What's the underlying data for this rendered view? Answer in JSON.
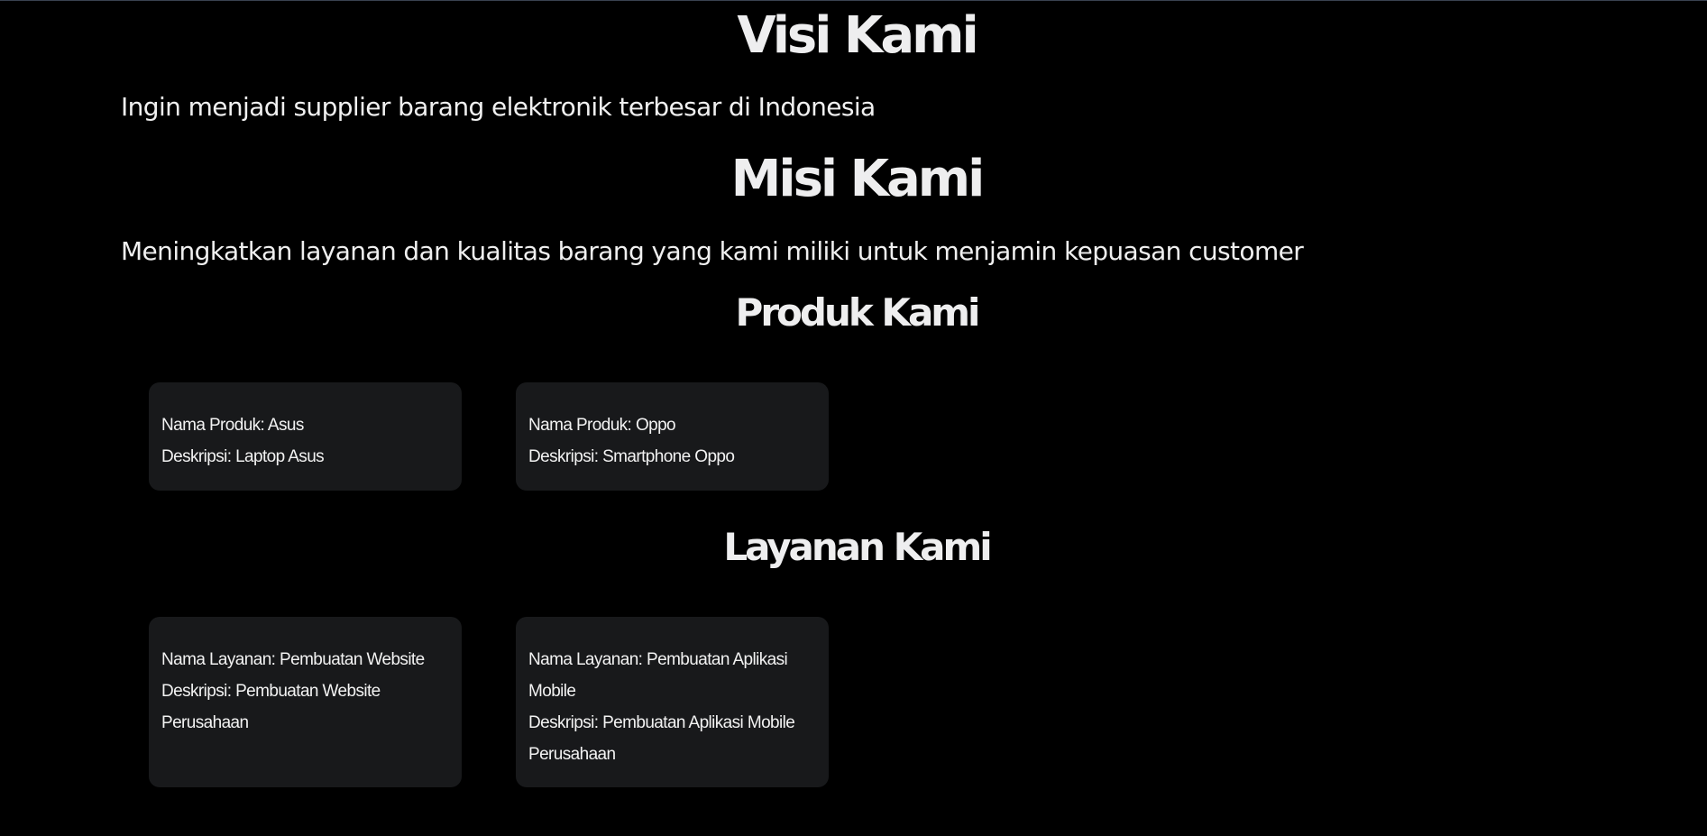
{
  "visi": {
    "title": "Visi Kami",
    "text": "Ingin menjadi supplier barang elektronik terbesar di Indonesia"
  },
  "misi": {
    "title": "Misi Kami",
    "text": "Meningkatkan layanan dan kualitas barang yang kami miliki untuk menjamin kepuasan customer"
  },
  "produk": {
    "title": "Produk Kami",
    "items": [
      {
        "name_label": "Nama Produk:",
        "name": "Asus",
        "desc_label": "Deskripsi:",
        "desc": "Laptop Asus"
      },
      {
        "name_label": "Nama Produk:",
        "name": "Oppo",
        "desc_label": "Deskripsi:",
        "desc": "Smartphone Oppo"
      }
    ]
  },
  "layanan": {
    "title": "Layanan Kami",
    "items": [
      {
        "name_label": "Nama Layanan:",
        "name": "Pembuatan Website",
        "desc_label": "Deskripsi:",
        "desc": "Pembuatan Website Perusahaan"
      },
      {
        "name_label": "Nama Layanan:",
        "name": "Pembuatan Aplikasi Mobile",
        "desc_label": "Deskripsi:",
        "desc": "Pembuatan Aplikasi Mobile Perusahaan"
      }
    ]
  },
  "colors": {
    "background": "#000000",
    "card": "#18191b",
    "text": "#f0f0f0"
  }
}
